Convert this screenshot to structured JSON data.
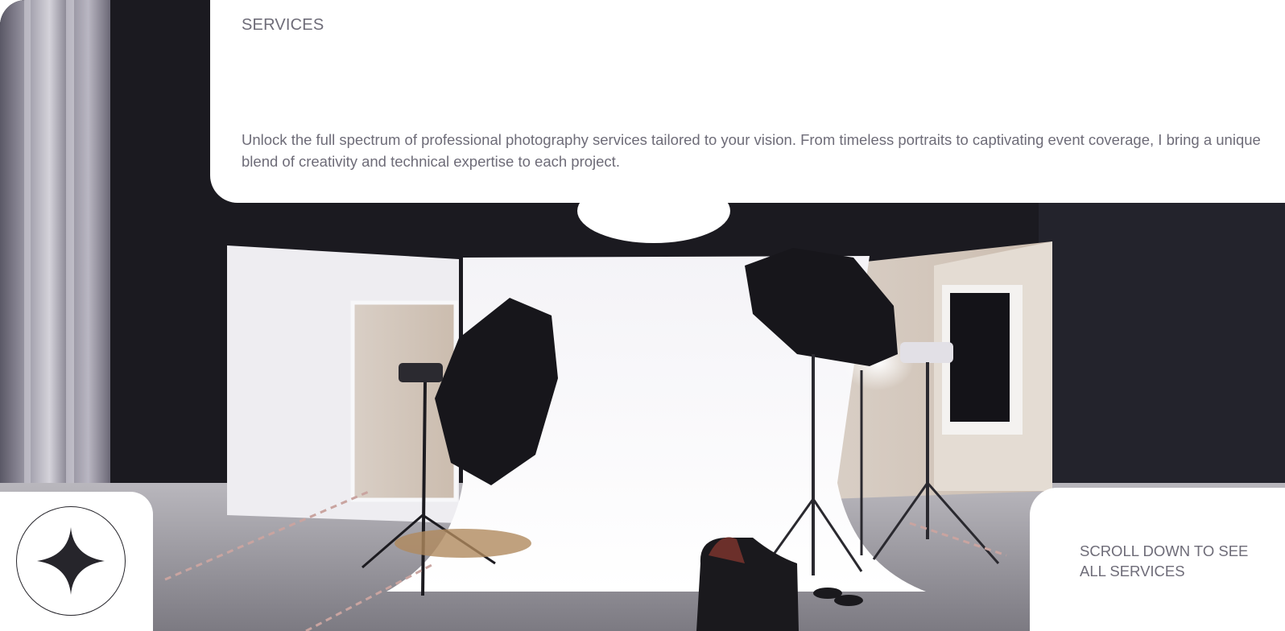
{
  "services": {
    "title": "SERVICES",
    "description": "Unlock the full spectrum of professional photography services tailored to your vision. From timeless portraits to captivating event coverage, I bring a unique blend of creativity and technical expertise to each project."
  },
  "hero": {
    "image": "photo-studio-image"
  },
  "badge": {
    "icon": "four-point-star-icon"
  },
  "scroll_hint": {
    "line1": "SCROLL DOWN TO SEE",
    "line2": "ALL SERVICES"
  },
  "colors": {
    "text_muted": "#6e6c78",
    "badge_stroke": "#26252b",
    "background": "#ffffff",
    "studio_dark": "#1b1a20"
  }
}
